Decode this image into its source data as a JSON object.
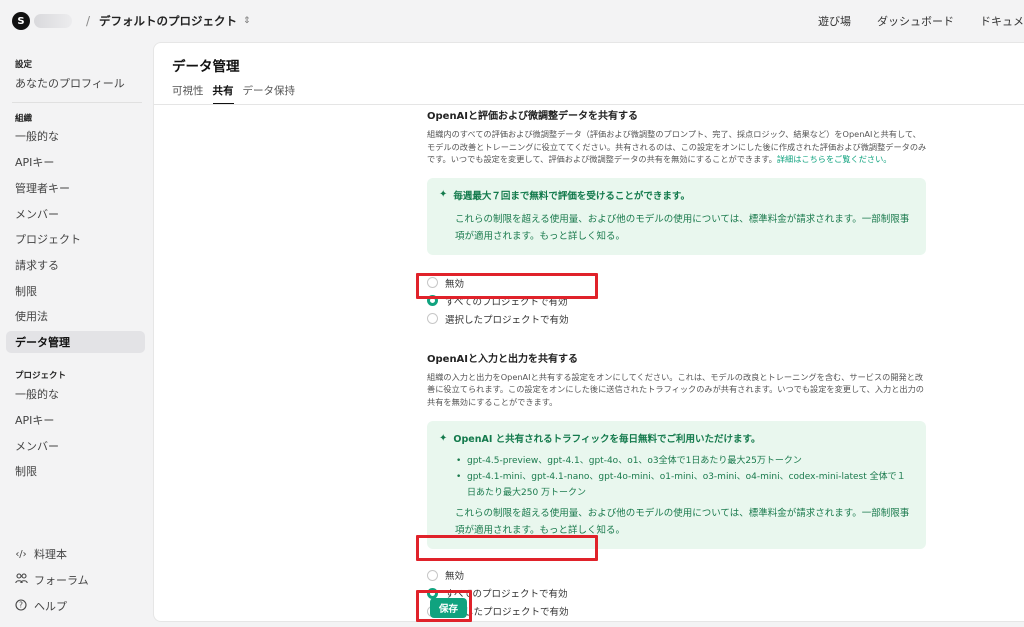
{
  "topbar": {
    "org_initial": "S",
    "separator": "/",
    "project": "デフォルトのプロジェクト",
    "nav": [
      "遊び場",
      "ダッシュボード",
      "ドキュメ"
    ]
  },
  "sidebar": {
    "settings_heading": "設定",
    "profile": "あなたのプロフィール",
    "org_heading": "組織",
    "org_items": [
      "一般的な",
      "APIキー",
      "管理者キー",
      "メンバー",
      "プロジェクト",
      "請求する",
      "制限",
      "使用法",
      "データ管理"
    ],
    "project_heading": "プロジェクト",
    "project_items": [
      "一般的な",
      "APIキー",
      "メンバー",
      "制限"
    ],
    "footer": {
      "cookbook": "料理本",
      "forum": "フォーラム",
      "help": "ヘルプ"
    }
  },
  "main": {
    "title": "データ管理",
    "tabs": [
      "可視性",
      "共有",
      "データ保持"
    ],
    "active_tab": "共有",
    "eval": {
      "title": "OpenAIと評価および微調整データを共有する",
      "desc": "組織内のすべての評価および微調整データ（評価および微調整のプロンプト、完了、採点ロジック、結果など）をOpenAIと共有して、モデルの改善とトレーニングに役立ててください。共有されるのは、この設定をオンにした後に作成された評価および微調整データのみです。いつでも設定を変更して、評価および微調整データの共有を無効にすることができます。",
      "link": "詳細はこちらをご覧ください。",
      "promo_title": "毎週最大７回まで無料で評価を受けることができます。",
      "promo_text": "これらの制限を超える使用量、および他のモデルの使用については、標準料金が請求されます。一部制限事項が適用されます。もっと詳しく知る。",
      "options": [
        "無効",
        "すべてのプロジェクトで有効",
        "選択したプロジェクトで有効"
      ],
      "selected_index": 1
    },
    "io": {
      "title": "OpenAIと入力と出力を共有する",
      "desc": "組織の入力と出力をOpenAIと共有する設定をオンにしてください。これは、モデルの改良とトレーニングを含む、サービスの開発と改善に役立てられます。この設定をオンにした後に送信されたトラフィックのみが共有されます。いつでも設定を変更して、入力と出力の共有を無効にすることができます。",
      "promo_title": "OpenAI と共有されるトラフィックを毎日無料でご利用いただけます。",
      "bullets": [
        "gpt-4.5-preview、gpt-4.1、gpt-4o、o1、o3全体で1日あたり最大25万トークン",
        "gpt-4.1-mini、gpt-4.1-nano、gpt-4o-mini、o1-mini、o3-mini、o4-mini、codex-mini-latest 全体で１日あたり最大250 万トークン"
      ],
      "promo_text": "これらの制限を超える使用量、および他のモデルの使用については、標準料金が請求されます。一部制限事項が適用されます。もっと詳しく知る。",
      "options": [
        "無効",
        "すべてのプロジェクトで有効",
        "選択したプロジェクトで有効"
      ],
      "selected_index": 1
    },
    "save_label": "保存"
  },
  "colors": {
    "accent": "#10a37f",
    "promo_bg": "#e9f7ee",
    "highlight": "#e0222a"
  }
}
